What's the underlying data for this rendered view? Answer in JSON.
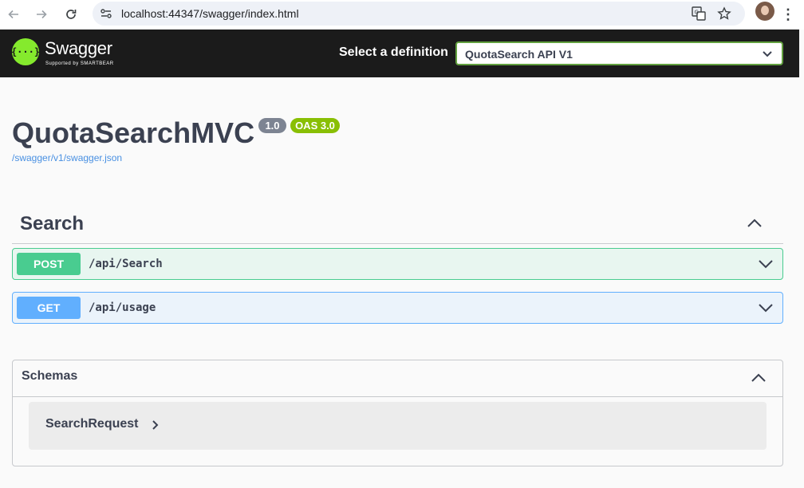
{
  "browser": {
    "url": "localhost:44347/swagger/index.html",
    "icons": [
      "back-arrow-icon",
      "forward-arrow-icon",
      "reload-icon",
      "site-info-icon",
      "translate-icon",
      "bookmark-star-icon",
      "profile-avatar",
      "menu-dots-icon"
    ]
  },
  "topbar": {
    "logo_name": "Swagger",
    "logo_sub": "Supported by SMARTBEAR",
    "logo_glyph": "{···}",
    "select_label": "Select a definition",
    "definition_selected": "QuotaSearch API V1",
    "colors": {
      "background": "#1b1b1b",
      "logo": "#85ea2d",
      "select_border": "#62a03f"
    }
  },
  "info": {
    "title": "QuotaSearchMVC",
    "version_badge": "1.0",
    "oas_badge": "OAS 3.0",
    "spec_link": "/swagger/v1/swagger.json"
  },
  "tag": {
    "name": "Search",
    "operations": [
      {
        "method": "POST",
        "path": "/api/Search",
        "color": "#49cc90"
      },
      {
        "method": "GET",
        "path": "/api/usage",
        "color": "#61affe"
      }
    ]
  },
  "schemas": {
    "title": "Schemas",
    "models": [
      {
        "name": "SearchRequest"
      }
    ]
  }
}
